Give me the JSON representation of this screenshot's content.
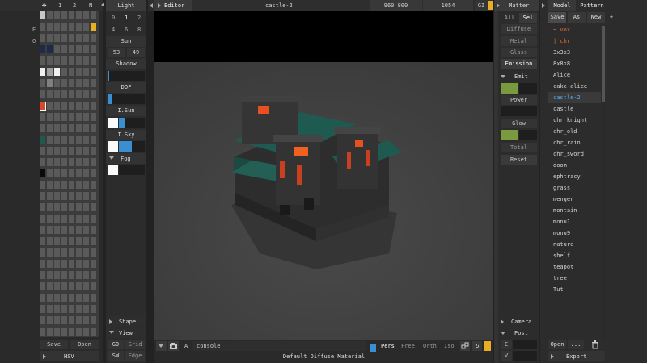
{
  "palette": {
    "tabs": [
      "1",
      "2",
      "N"
    ],
    "letters": [
      "E",
      "O"
    ],
    "save_label": "Save",
    "open_label": "Open",
    "hsv_label": "HSV",
    "selected_color": "#d44a2a",
    "swatches": [
      {
        "col": 0,
        "row": 0,
        "color": "#c8c8c8"
      },
      {
        "col": 7,
        "row": 1,
        "color": "#e8b020"
      },
      {
        "col": 0,
        "row": 3,
        "color": "#1e2a4a"
      },
      {
        "col": 1,
        "row": 3,
        "color": "#1e2a4a"
      },
      {
        "col": 0,
        "row": 5,
        "color": "#f0f0f0"
      },
      {
        "col": 1,
        "row": 5,
        "color": "#a0a0a0"
      },
      {
        "col": 2,
        "row": 5,
        "color": "#f0f0f0"
      },
      {
        "col": 1,
        "row": 6,
        "color": "#808080"
      },
      {
        "col": 0,
        "row": 8,
        "color": "#d44a2a"
      },
      {
        "col": 0,
        "row": 11,
        "color": "#1e5a50"
      },
      {
        "col": 0,
        "row": 14,
        "color": "#0a0a0a"
      }
    ]
  },
  "light": {
    "title": "Light",
    "row1": [
      "0",
      "1",
      "2"
    ],
    "row2": [
      "4",
      "6",
      "8"
    ],
    "sun_label": "Sun",
    "sun_values": [
      "53",
      "49"
    ],
    "shadow_label": "Shadow",
    "dof_label": "DOF",
    "isun_label": "I.Sun",
    "isky_label": "I.Sky",
    "fog_label": "Fog",
    "shape_label": "Shape",
    "view_label": "View",
    "gd_label": "GD",
    "grid_label": "Grid",
    "sw_label": "SW",
    "edge_label": "Edge"
  },
  "toolbar": {
    "editor_label": "Editor",
    "file_name": "castle-2",
    "dimensions": "960 800",
    "sample_count": "1054",
    "gi_label": "GI"
  },
  "bottombar": {
    "a_label": "A",
    "console_placeholder": "console",
    "view_modes": [
      "Pers",
      "Free",
      "Orth",
      "Iso"
    ],
    "status": "Default Diffuse Material"
  },
  "matter": {
    "title": "Matter",
    "all_label": "All",
    "sel_label": "Sel",
    "materials": [
      "Diffuse",
      "Metal",
      "Glass",
      "Emission"
    ],
    "emit_label": "Emit",
    "emit_color": "#7a9a40",
    "power_label": "Power",
    "glow_label": "Glow",
    "glow_color": "#7a9a40",
    "total_label": "Total",
    "reset_label": "Reset",
    "camera_label": "Camera",
    "post_label": "Post",
    "e_label": "E",
    "v_label": "V"
  },
  "model": {
    "tab_model": "Model",
    "tab_pattern": "Pattern",
    "save_label": "Save",
    "as_label": "As",
    "new_label": "New",
    "plus_label": "+",
    "items": [
      "~ vox",
      "| chr",
      "3x3x3",
      "8x8x8",
      "Alice",
      "cake-alice",
      "castle-2",
      "castle",
      "chr_knight",
      "chr_old",
      "chr_rain",
      "chr_sword",
      "doom",
      "ephtracy",
      "grass",
      "menger",
      "montain",
      "monu1",
      "monu9",
      "nature",
      "shelf",
      "teapot",
      "tree",
      "Tut"
    ],
    "selected_index": 6,
    "open_label": "Open",
    "more_label": "...",
    "export_label": "Export"
  }
}
